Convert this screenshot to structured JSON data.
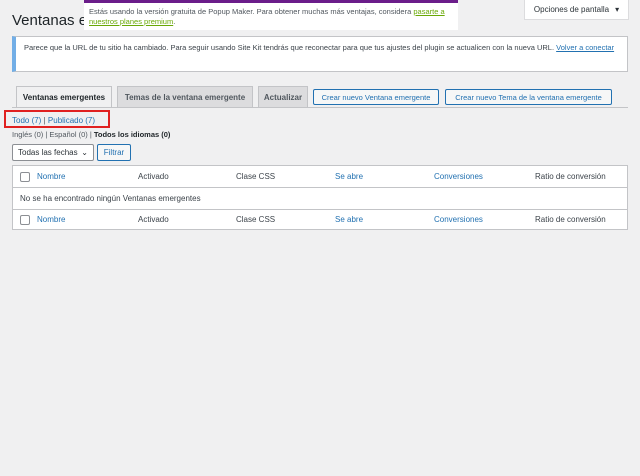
{
  "page": {
    "title": "Ventanas en"
  },
  "promo": {
    "text_1": "Estás usando la versión gratuita de Popup Maker. Para obtener muchas más ventajas, considera",
    "link": "pasarte a nuestros planes premium",
    "text_2": "."
  },
  "screen_options": {
    "label": "Opciones de pantalla",
    "icon": "chevron-down-icon"
  },
  "notice": {
    "text": "Parece que la URL de tu sitio ha cambiado. Para seguir usando Site Kit tendrás que reconectar para que tus ajustes del plugin se actualicen con la nueva URL.",
    "link": "Volver a conectar"
  },
  "tabs": [
    {
      "label": "Ventanas emergentes"
    },
    {
      "label": "Temas de la ventana emergente"
    },
    {
      "label": "Actualizar"
    }
  ],
  "buttons": {
    "create_popup": "Crear nuevo Ventana emergente",
    "create_theme": "Crear nuevo Tema de la ventana emergente",
    "filter": "Filtrar"
  },
  "views": {
    "all": "Todo (7)",
    "separator": "|",
    "published": "Publicado (7)"
  },
  "languages": {
    "english": "Inglés (0)",
    "spanish": "Español (0)",
    "all": "Todos los idiomas (0)"
  },
  "date_filter": {
    "selected": "Todas las fechas"
  },
  "table": {
    "columns": [
      "Nombre",
      "Activado",
      "Clase CSS",
      "Se abre",
      "Conversiones",
      "Ratio de conversión"
    ],
    "empty_message": "No se ha encontrado ningún Ventanas emergentes"
  },
  "colors": {
    "accent": "#2271b1",
    "promo_link": "#69a805",
    "promo_bar": "#6b1d8a",
    "notice_border": "#72aee6",
    "highlight": "#e02020"
  }
}
